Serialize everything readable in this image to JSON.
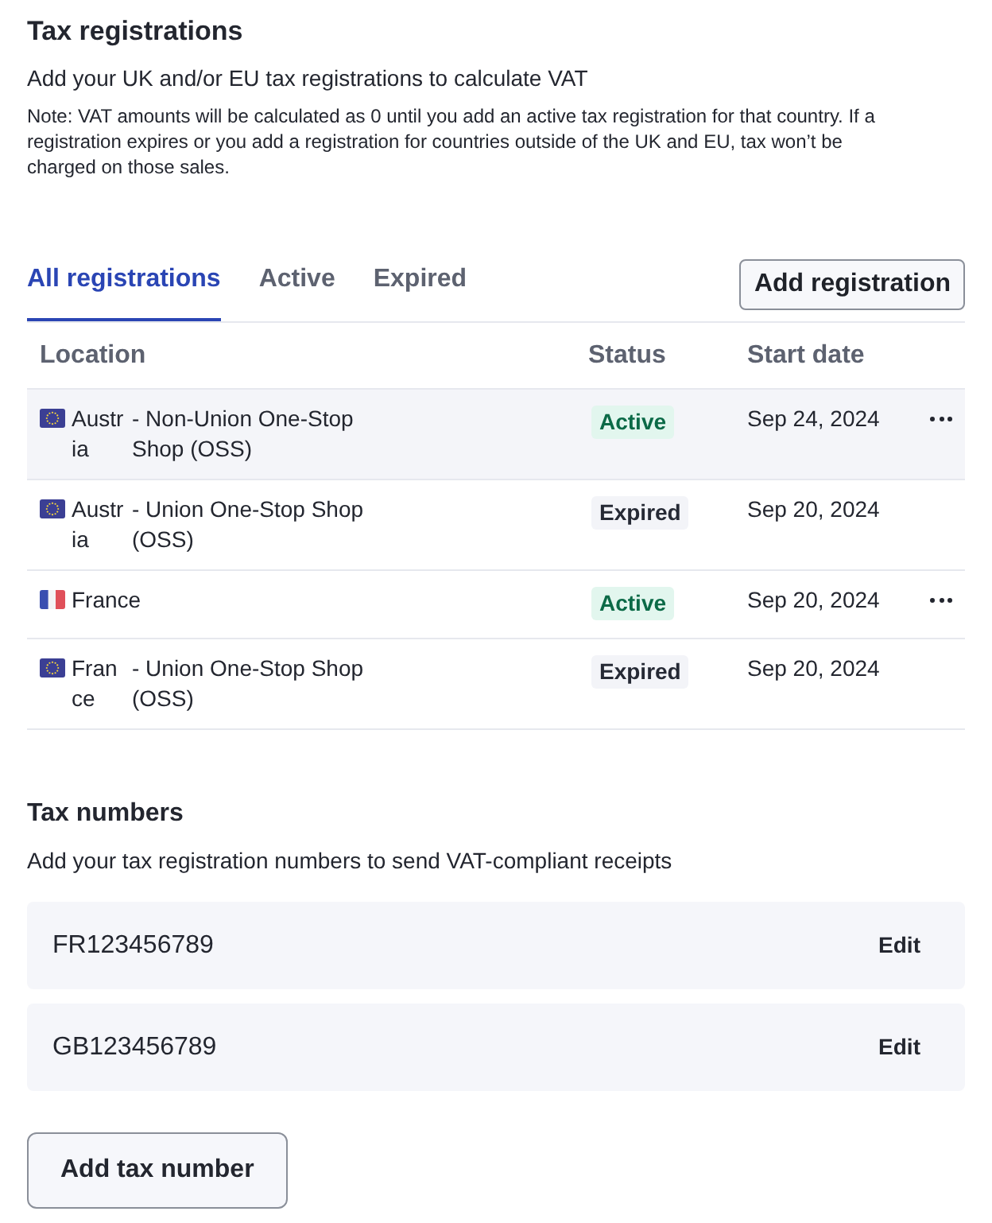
{
  "tax_registrations": {
    "title": "Tax registrations",
    "subtitle": "Add your UK and/or EU tax registrations to calculate VAT",
    "note": "Note: VAT amounts will be calculated as 0 until you add an active tax registration for that country. If a registration expires or you add a registration for countries outside of the UK and EU, tax won’t be charged on those sales."
  },
  "tabs": [
    {
      "label": "All registrations",
      "selected": true
    },
    {
      "label": "Active",
      "selected": false
    },
    {
      "label": "Expired",
      "selected": false
    }
  ],
  "add_registration_button": "Add registration",
  "table": {
    "columns": [
      "Location",
      "Status",
      "Start date"
    ],
    "rows": [
      {
        "flag": {
          "kind": "eu"
        },
        "country": "Austria",
        "scheme": "- Non-Union One-Stop Shop (OSS)",
        "status": {
          "label": "Active",
          "kind": "active"
        },
        "start_date": "Sep 24, 2024",
        "highlighted": true,
        "more_menu": true
      },
      {
        "flag": {
          "kind": "eu"
        },
        "country": "Austria",
        "scheme": "- Union One-Stop Shop (OSS)",
        "status": {
          "label": "Expired",
          "kind": "expired"
        },
        "start_date": "Sep 20, 2024",
        "highlighted": false,
        "more_menu": false
      },
      {
        "flag": {
          "kind": "fr"
        },
        "country": "France",
        "status": {
          "label": "Active",
          "kind": "active"
        },
        "start_date": "Sep 20, 2024",
        "highlighted": false,
        "more_menu": true
      },
      {
        "flag": {
          "kind": "eu"
        },
        "country": "France",
        "scheme": "- Union One-Stop Shop (OSS)",
        "status": {
          "label": "Expired",
          "kind": "expired"
        },
        "start_date": "Sep 20, 2024",
        "highlighted": false,
        "more_menu": false
      }
    ]
  },
  "tax_numbers": {
    "title": "Tax numbers",
    "subtitle": "Add your tax registration numbers to send VAT-compliant receipts",
    "items": [
      {
        "number": "FR123456789",
        "action": "Edit"
      },
      {
        "number": "GB123456789",
        "action": "Edit"
      }
    ],
    "add_button": "Add tax number"
  }
}
